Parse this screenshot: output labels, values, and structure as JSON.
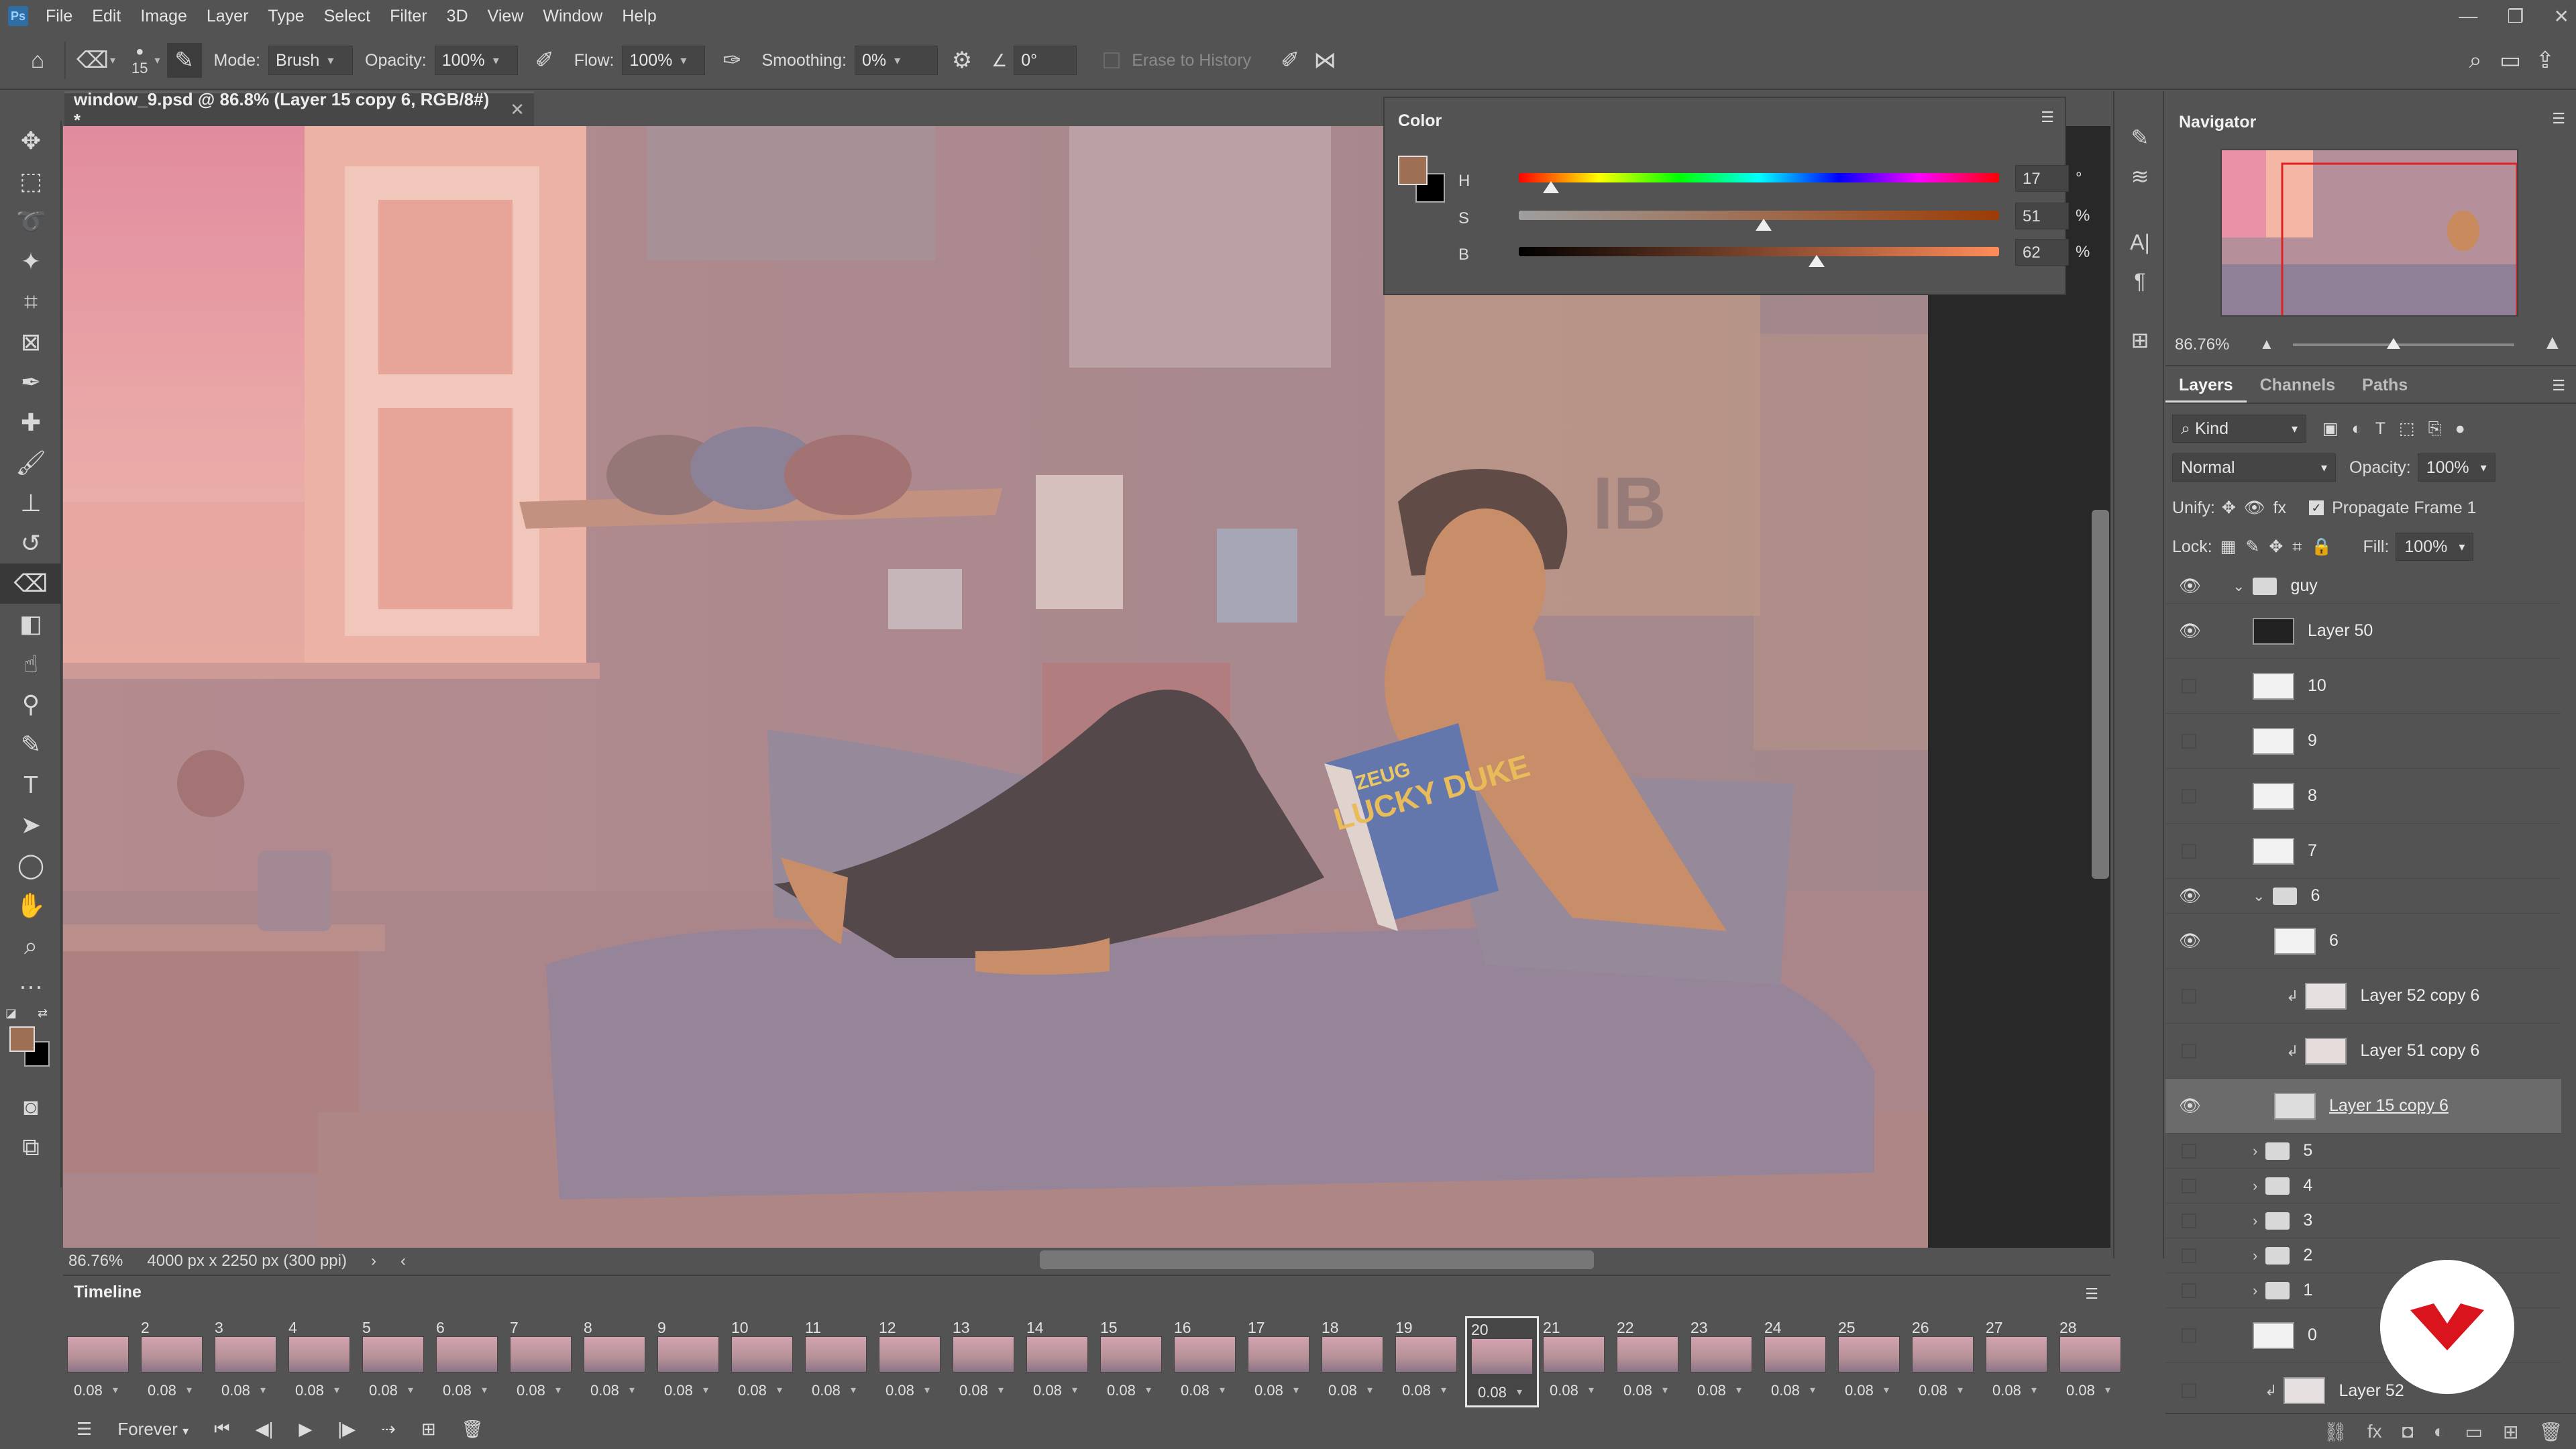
{
  "app": {
    "logo_text": "Ps",
    "menu": [
      "File",
      "Edit",
      "Image",
      "Layer",
      "Type",
      "Select",
      "Filter",
      "3D",
      "View",
      "Window",
      "Help"
    ]
  },
  "options_bar": {
    "brush_size": "15",
    "mode_label": "Mode:",
    "mode_value": "Brush",
    "opacity_label": "Opacity:",
    "opacity_value": "100%",
    "flow_label": "Flow:",
    "flow_value": "100%",
    "smoothing_label": "Smoothing:",
    "smoothing_value": "0%",
    "angle_value": "0°",
    "erase_history_label": "Erase to History"
  },
  "document": {
    "tab_title": "window_9.psd @ 86.8% (Layer 15 copy 6, RGB/8#) *",
    "zoom": "86.76%",
    "doc_info": "4000 px x 2250 px (300 ppi)",
    "magazine_text_top": "ZEUG",
    "magazine_text_main": "LUCKY DUKE",
    "wall_letters": "IB"
  },
  "color_panel": {
    "title": "Color",
    "foreground": "#9d6f54",
    "background": "#000000",
    "h_label": "H",
    "h_value": "17",
    "h_unit": "°",
    "s_label": "S",
    "s_value": "51",
    "s_unit": "%",
    "b_label": "B",
    "b_value": "62",
    "b_unit": "%"
  },
  "navigator": {
    "title": "Navigator",
    "zoom": "86.76%"
  },
  "layers_panel": {
    "tabs": [
      "Layers",
      "Channels",
      "Paths"
    ],
    "filter_kind": "Kind",
    "blend_mode": "Normal",
    "opacity_label": "Opacity:",
    "opacity_value": "100%",
    "unify_label": "Unify:",
    "propagate_label": "Propagate Frame 1",
    "lock_label": "Lock:",
    "fill_label": "Fill:",
    "fill_value": "100%",
    "layers": [
      {
        "name": "guy",
        "type": "group",
        "visible": true,
        "expanded": true
      },
      {
        "name": "Layer 50",
        "type": "layer",
        "visible": true
      },
      {
        "name": "10",
        "type": "layer",
        "visible": false
      },
      {
        "name": "9",
        "type": "layer",
        "visible": false
      },
      {
        "name": "8",
        "type": "layer",
        "visible": false
      },
      {
        "name": "7",
        "type": "layer",
        "visible": false
      },
      {
        "name": "6",
        "type": "group",
        "visible": true,
        "expanded": true
      },
      {
        "name": "6",
        "type": "layer",
        "visible": true
      },
      {
        "name": "Layer 52 copy 6",
        "type": "clip",
        "visible": false
      },
      {
        "name": "Layer 51 copy 6",
        "type": "clip",
        "visible": false
      },
      {
        "name": "Layer 15 copy 6",
        "type": "layer",
        "visible": true,
        "selected": true
      },
      {
        "name": "5",
        "type": "group",
        "visible": false
      },
      {
        "name": "4",
        "type": "group",
        "visible": false
      },
      {
        "name": "3",
        "type": "group",
        "visible": false
      },
      {
        "name": "2",
        "type": "group",
        "visible": false
      },
      {
        "name": "1",
        "type": "group",
        "visible": false
      },
      {
        "name": "0",
        "type": "layer",
        "visible": false
      },
      {
        "name": "Layer 52",
        "type": "clip",
        "visible": false
      }
    ]
  },
  "timeline": {
    "title": "Timeline",
    "loop": "Forever",
    "current_frame": "20",
    "delay": "0.08",
    "frames": [
      "",
      "2",
      "3",
      "4",
      "5",
      "6",
      "7",
      "8",
      "9",
      "10",
      "11",
      "12",
      "13",
      "14",
      "15",
      "16",
      "17",
      "18",
      "19",
      "20",
      "21",
      "22",
      "23",
      "24",
      "25",
      "26",
      "27",
      "28"
    ]
  }
}
